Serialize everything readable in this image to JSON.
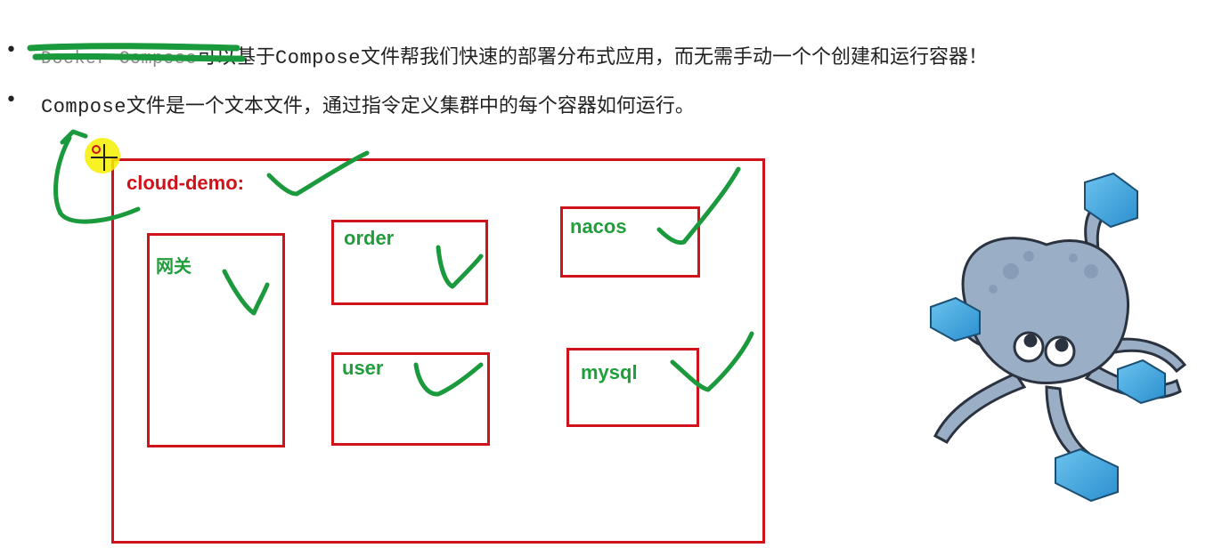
{
  "bullets": [
    {
      "prefix": "Docker Compose",
      "text": "可以基于",
      "code": "Compose",
      "rest": "文件帮我们快速的部署分布式应用，而无需手动一个个创建和运行容器！"
    },
    {
      "code": "Compose",
      "rest": "文件是一个文本文件，通过指令定义集群中的每个容器如何运行。"
    }
  ],
  "bullet_glyph": "•",
  "diagram": {
    "outer_label": "cloud-demo:",
    "services": [
      "网关",
      "order",
      "nacos",
      "user",
      "mysql"
    ]
  },
  "colors": {
    "box_border": "#d0121b",
    "outer_label": "#d0121b",
    "service_label": "#1f9e3a",
    "annotation": "#1a9a3c"
  },
  "icons": {
    "mascot": "docker-compose-octopus"
  }
}
